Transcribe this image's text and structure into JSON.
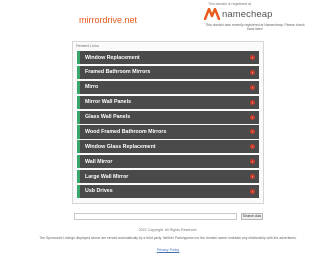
{
  "header": {
    "domain": "mirrordrive.net",
    "registrar_note": "This domain is registered at",
    "registrar_name": "namecheap",
    "registrar_tagline": "This domain was recently registered at Namecheap. Please check back later!"
  },
  "related": {
    "heading": "Related Links",
    "links": [
      {
        "label": "Window Replacement"
      },
      {
        "label": "Framed Bathroom Mirrors"
      },
      {
        "label": "Mirro"
      },
      {
        "label": "Mirror Wall Panels"
      },
      {
        "label": "Glass Wall Panels"
      },
      {
        "label": "Wood Framed Bathroom Mirrors"
      },
      {
        "label": "Window Glass Replacement"
      },
      {
        "label": "Wall Mirror"
      },
      {
        "label": "Large Wall Mirror"
      },
      {
        "label": "Usb Drives"
      }
    ],
    "arrow_glyph": "›"
  },
  "search": {
    "placeholder": "",
    "button_label": "Search Ads"
  },
  "footer": {
    "copyright": "2022 Copyright. All Rights Reserved.",
    "disclaimer": "The Sponsored Listings displayed above are served automatically by a third party. Neither Parkingcrew nor the domain owner maintain any relationship with the advertisers.",
    "privacy_label": "Privacy Policy"
  },
  "colors": {
    "accent_orange": "#e85a1a",
    "link_row_bg": "#4a4a4a",
    "link_row_border": "#3aa66b",
    "arrow_bg": "#c73a2a"
  }
}
